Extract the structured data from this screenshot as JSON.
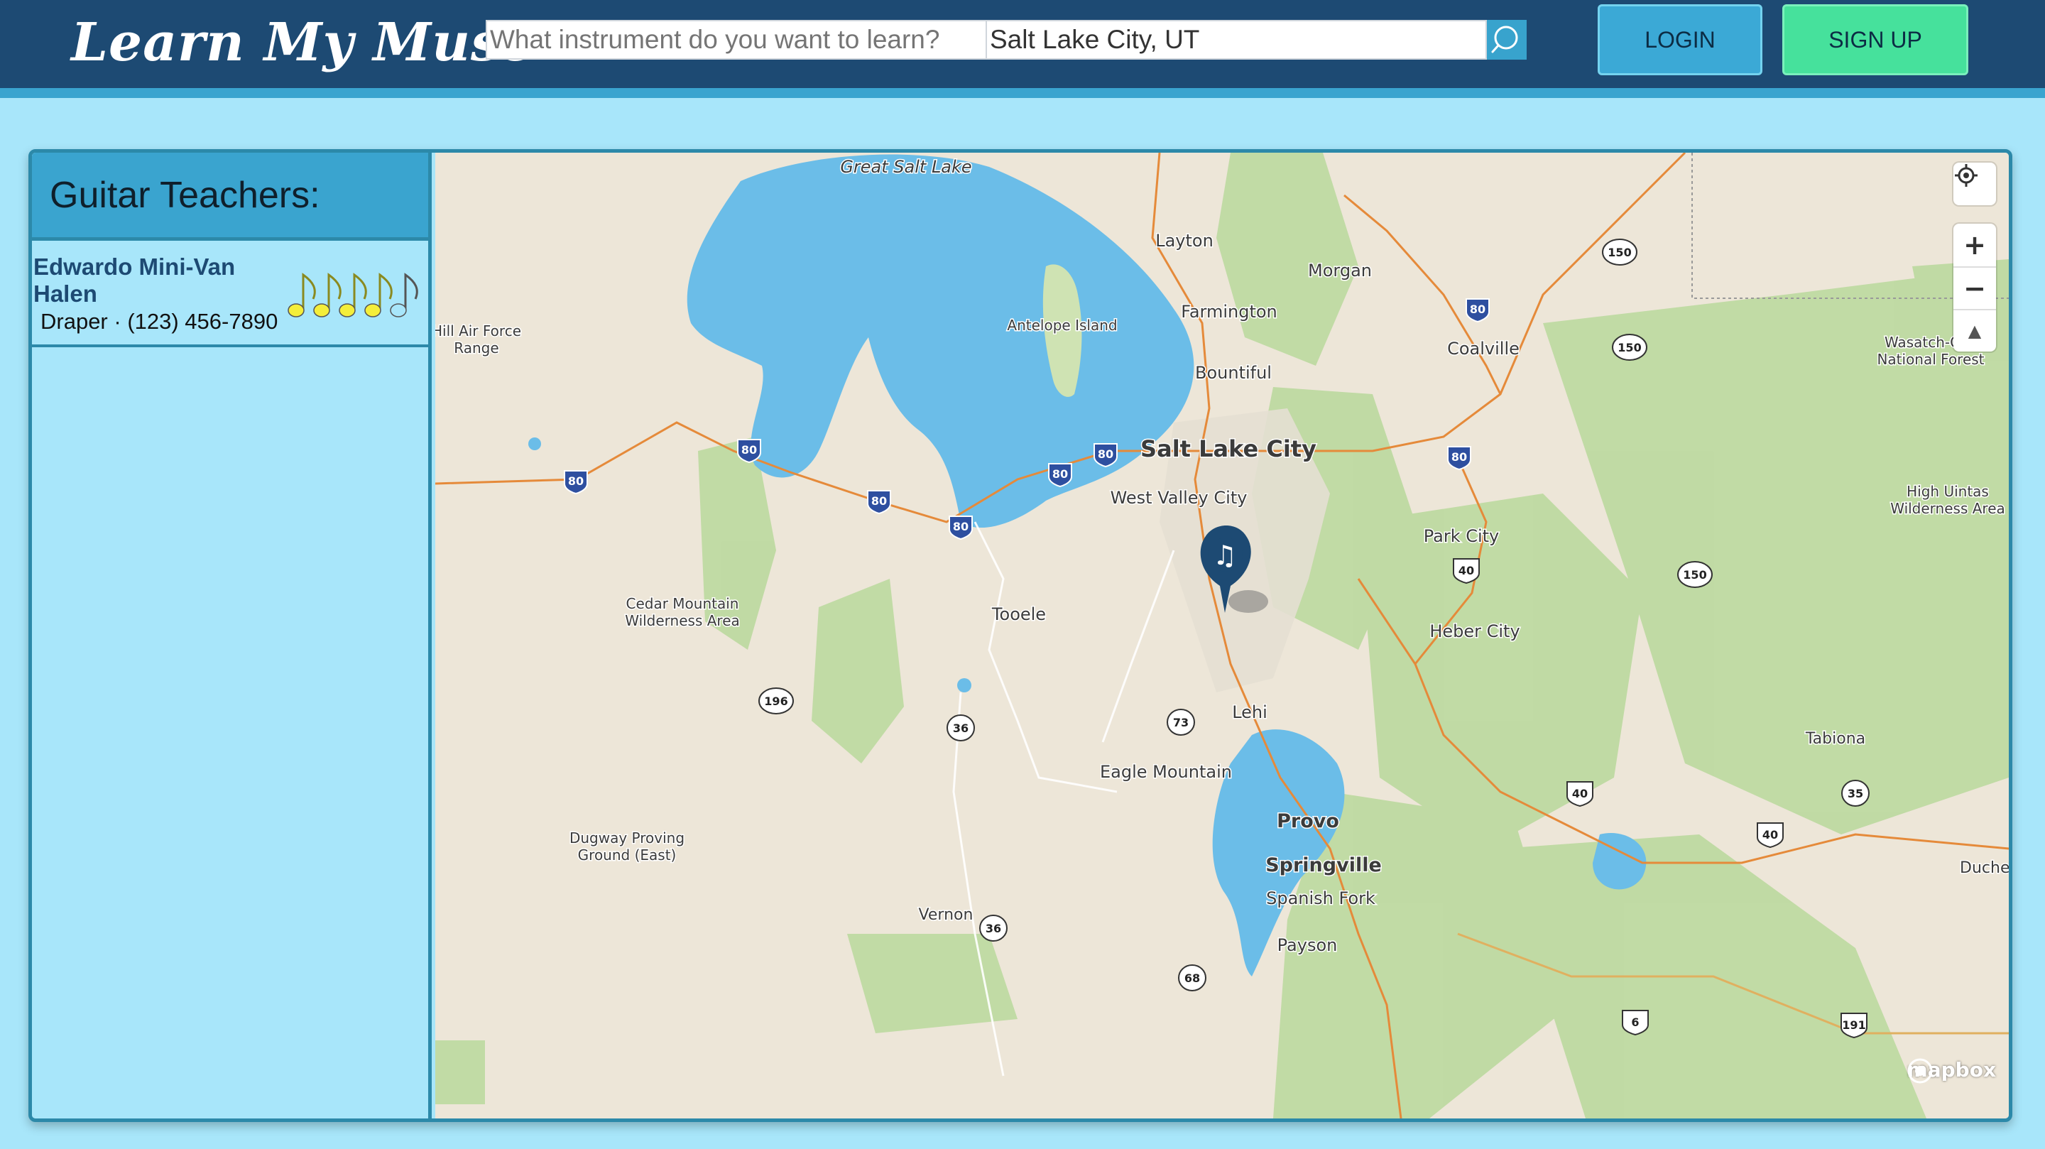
{
  "header": {
    "logo": "Learn My Muse",
    "search": {
      "instrument_placeholder": "What instrument do you want to learn?",
      "location_value": "Salt Lake City, UT"
    },
    "login_label": "LOGIN",
    "signup_label": "SIGN UP"
  },
  "sidebar": {
    "title": "Guitar Teachers:",
    "teachers": [
      {
        "name": "Edwardo Mini-Van Halen",
        "location": "Draper",
        "phone": "(123) 456-7890",
        "rating": 4
      }
    ]
  },
  "map": {
    "attribution": "mapbox",
    "labels": {
      "great_salt_lake": "Great Salt Lake",
      "antelope_island": "Antelope Island",
      "layton": "Layton",
      "morgan": "Morgan",
      "farmington": "Farmington",
      "bountiful": "Bountiful",
      "coalville": "Coalville",
      "salt_lake_city": "Salt Lake City",
      "west_valley_city": "West Valley City",
      "park_city": "Park City",
      "hill_air_force": "Hill Air Force",
      "range": "Range",
      "cedar_mountain_1": "Cedar Mountain",
      "cedar_mountain_2": "Wilderness Area",
      "tooele": "Tooele",
      "heber_city": "Heber City",
      "lehi": "Lehi",
      "eagle_mountain": "Eagle Mountain",
      "tabiona": "Tabiona",
      "provo": "Provo",
      "springville": "Springville",
      "spanish_fork": "Spanish Fork",
      "payson": "Payson",
      "dugway_1": "Dugway Proving",
      "dugway_2": "Ground (East)",
      "vernon": "Vernon",
      "wasatch_1": "Wasatch-C",
      "wasatch_2": "National Forest",
      "high_uintas_1": "High Uintas",
      "high_uintas_2": "Wilderness Area",
      "duchesne": "Duches"
    },
    "shields": {
      "i80": "80",
      "r150": "150",
      "u40": "40",
      "r196": "196",
      "r36": "36",
      "r73": "73",
      "r35": "35",
      "u6": "6",
      "u191": "191",
      "r68": "68"
    },
    "controls": {
      "zoom_in": "+",
      "zoom_out": "−",
      "compass": "▲"
    }
  },
  "colors": {
    "header_bg": "#1d4a73",
    "accent": "#3aa4cf",
    "page_bg": "#a8e6fa",
    "signup_green": "#46e19c",
    "note_yellow": "#f4ee3a",
    "pin": "#1d4a73"
  }
}
